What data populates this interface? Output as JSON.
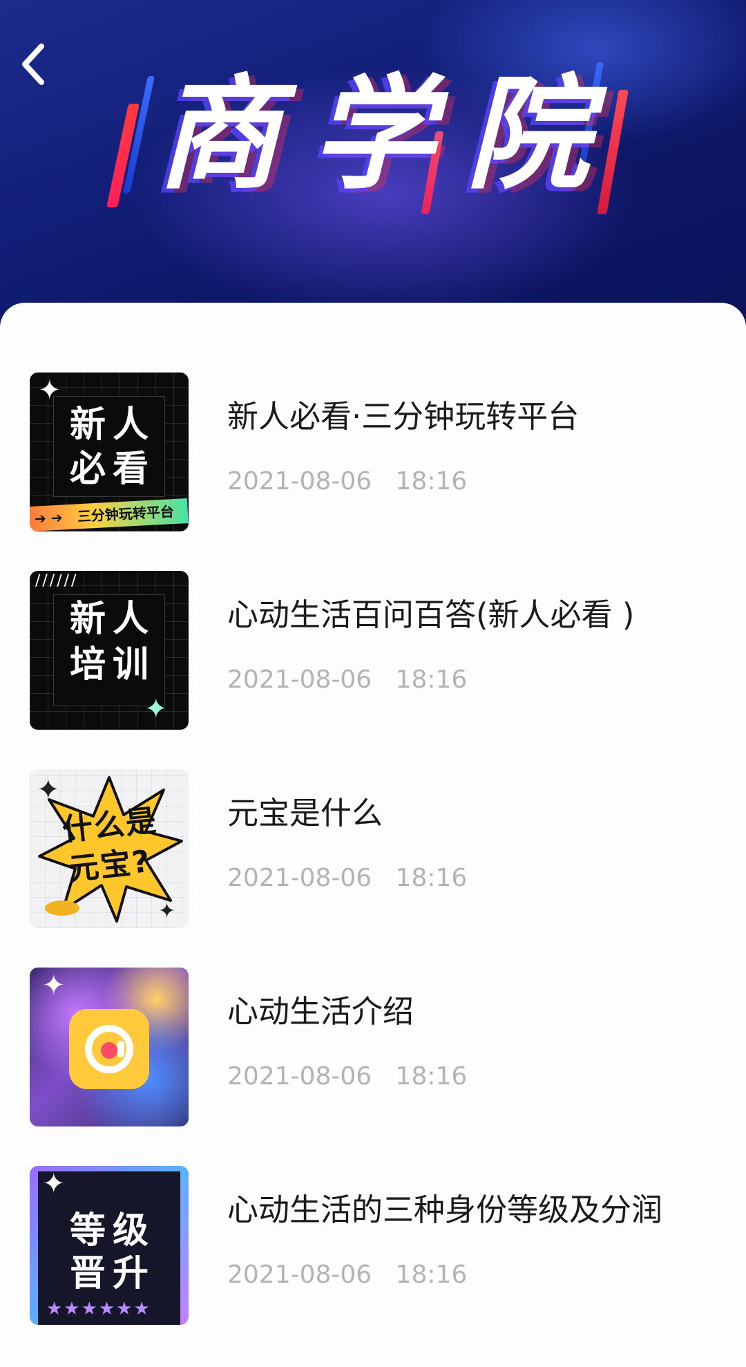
{
  "header": {
    "title": "商学院",
    "back_icon": "chevron-left-icon"
  },
  "items": [
    {
      "title": "新人必看·三分钟玩转平台",
      "time": "2021-08-06   18:16",
      "thumb": {
        "lines": [
          "新人",
          "必看"
        ],
        "strip": "三分钟玩转平台",
        "style": "dark"
      }
    },
    {
      "title": "心动生活百问百答(新人必看 )",
      "time": "2021-08-06   18:16",
      "thumb": {
        "lines": [
          "新人",
          "培训"
        ],
        "style": "dark"
      }
    },
    {
      "title": "元宝是什么",
      "time": "2021-08-06   18:16",
      "thumb": {
        "lines": [
          "什么是",
          "元宝?"
        ],
        "style": "burst"
      }
    },
    {
      "title": "心动生活介绍",
      "time": "2021-08-06   18:16",
      "thumb": {
        "icon": "app-logo-icon",
        "style": "marble"
      }
    },
    {
      "title": "心动生活的三种身份等级及分润",
      "time": "2021-08-06   18:16",
      "thumb": {
        "lines": [
          "等级",
          "晋升"
        ],
        "style": "level"
      }
    }
  ],
  "colors": {
    "banner": "#13207a",
    "title_text": "#1a1a1a",
    "time_text": "#b3b3b3",
    "accent_red": "#ff3b3b",
    "accent_yellow": "#ffc93c"
  }
}
